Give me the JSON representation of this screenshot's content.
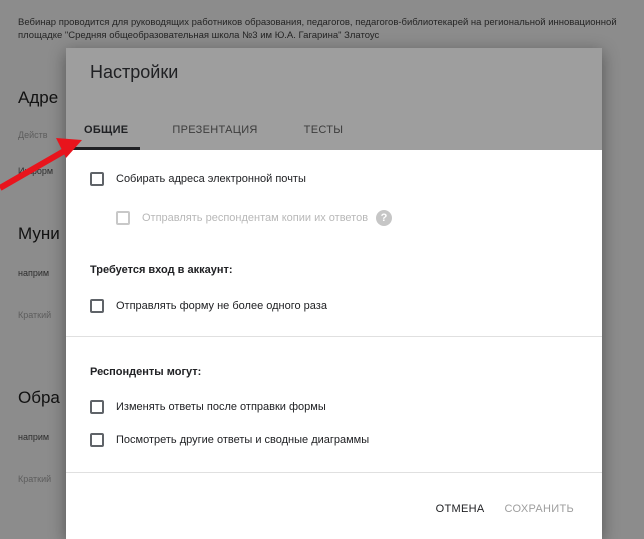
{
  "background": {
    "description": "Вебинар проводится для руководящих работников образования, педагогов, педагогов-библиотекарей на региональной инновационной площадке \"Средняя общеобразовательная школа №3 им Ю.А. Гагарина\" Златоус",
    "section1_title": "Адре",
    "section1_input": "Действ",
    "section1_hint": "Информ",
    "section2_title": "Муни",
    "section2_hint": "наприм",
    "section2_input": "Краткий",
    "section3_title": "Обра",
    "section3_hint": "наприм",
    "section3_input": "Краткий"
  },
  "dialog": {
    "title": "Настройки",
    "tabs": [
      {
        "label": "ОБЩИЕ",
        "active": true
      },
      {
        "label": "ПРЕЗЕНТАЦИЯ",
        "active": false
      },
      {
        "label": "ТЕСТЫ",
        "active": false
      }
    ],
    "collect_emails": "Собирать адреса электронной почты",
    "send_copies": "Отправлять респондентам копии их ответов",
    "login_required": "Требуется вход в аккаунт:",
    "limit_one": "Отправлять форму не более одного раза",
    "respondents_can": "Респонденты могут:",
    "edit_after": "Изменять ответы после отправки формы",
    "see_summary": "Посмотреть другие ответы и сводные диаграммы",
    "cancel": "ОТМЕНА",
    "save": "СОХРАНИТЬ"
  },
  "colors": {
    "header_bg": "#9e9e9e",
    "arrow": "#e8141c"
  }
}
